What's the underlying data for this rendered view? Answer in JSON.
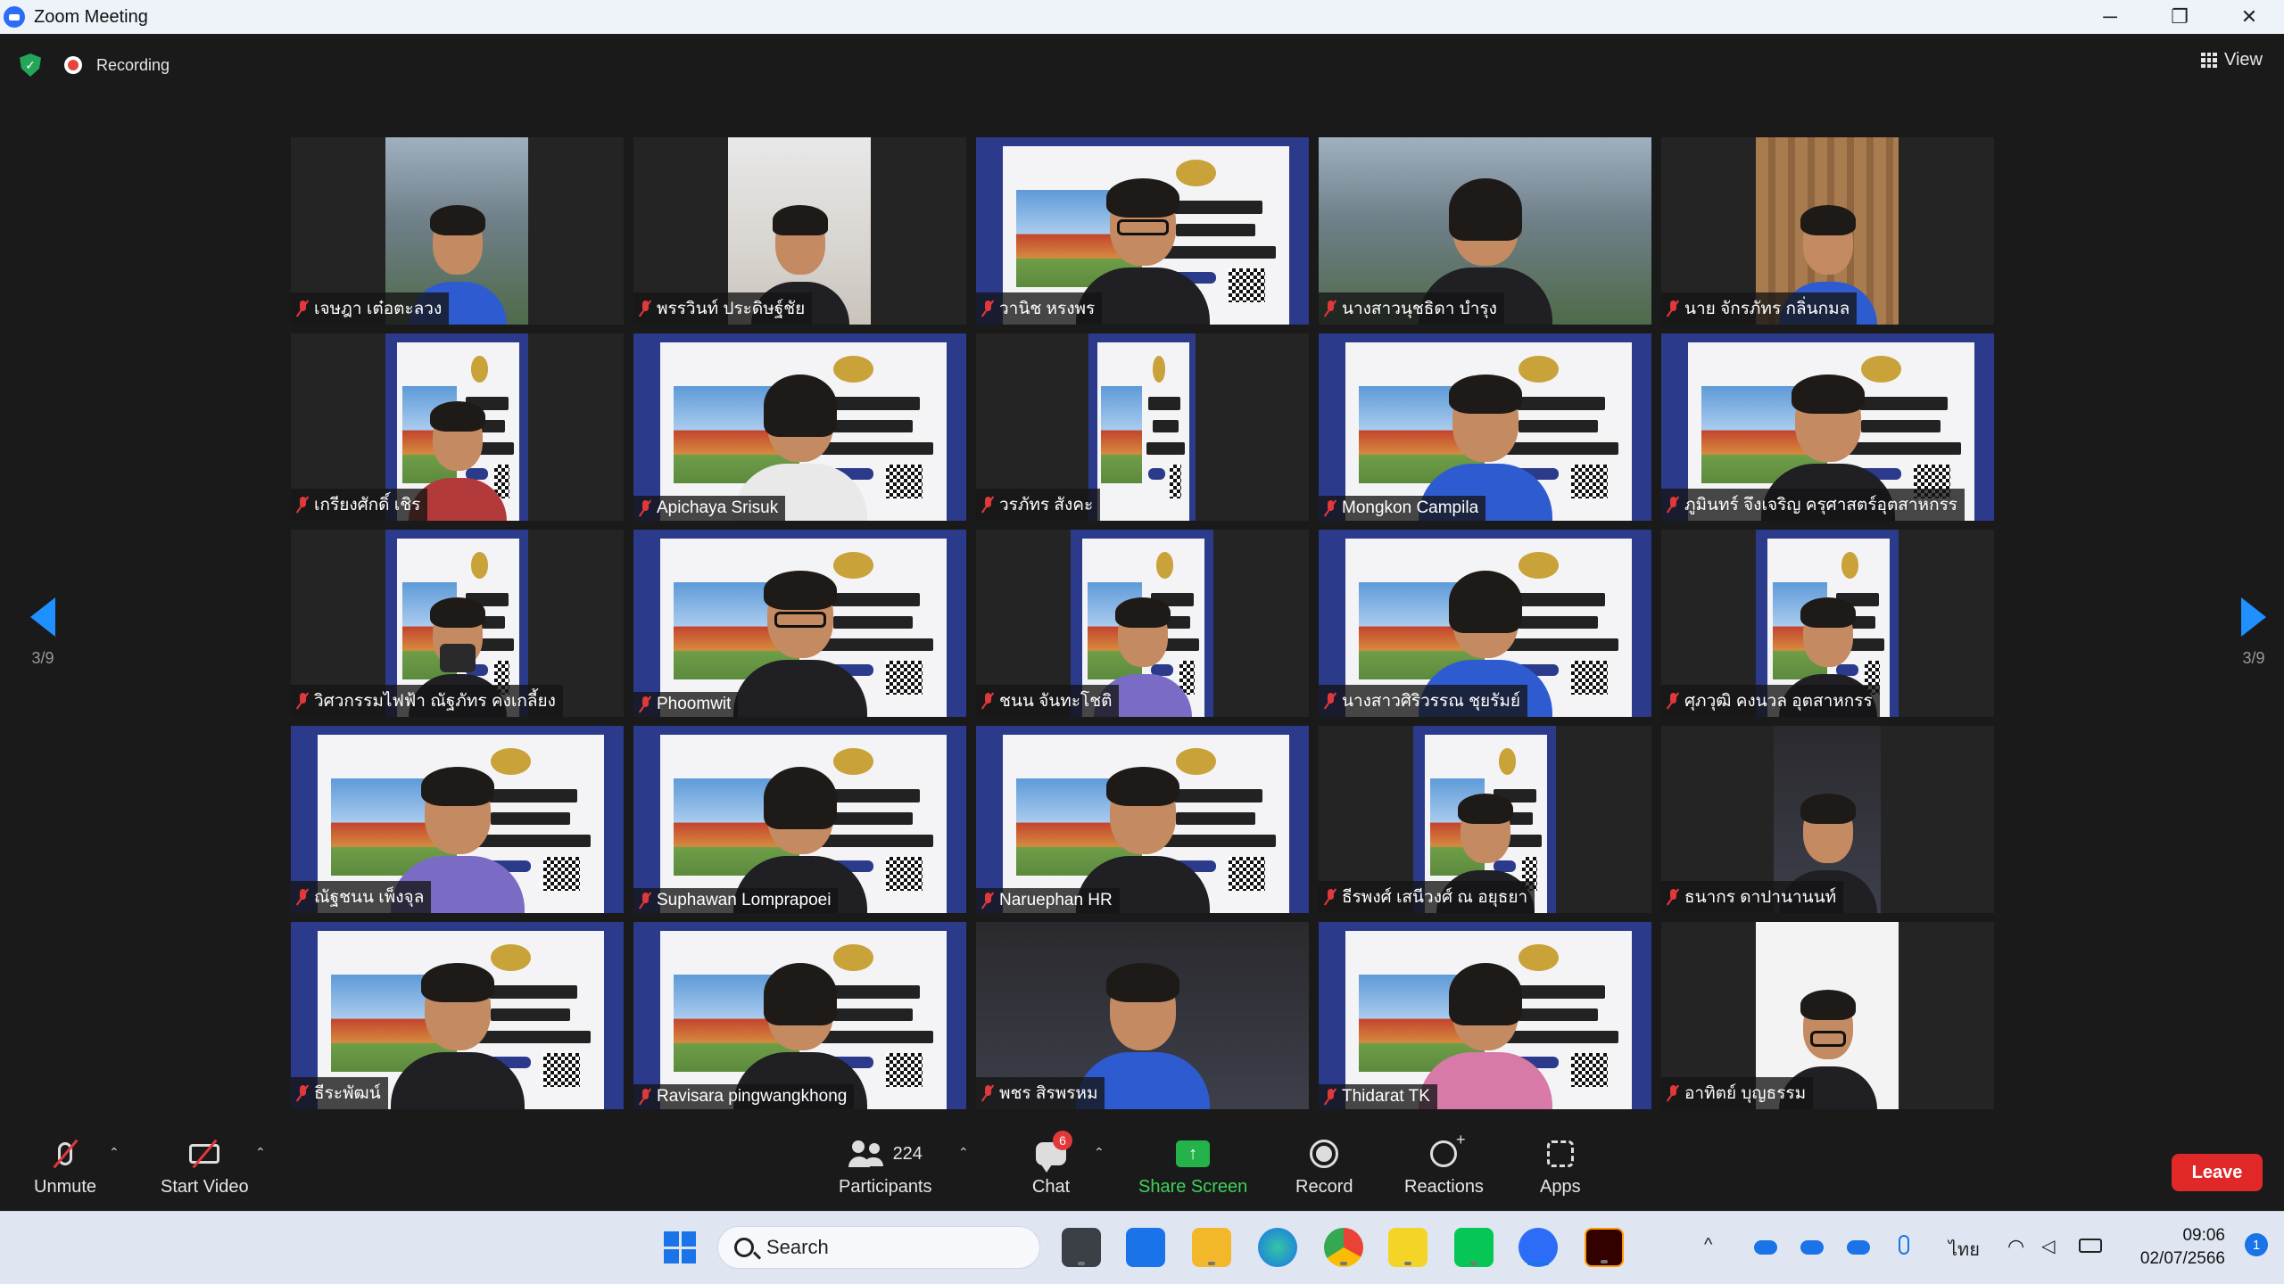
{
  "window": {
    "title": "Zoom Meeting",
    "minimize_glyph": "─",
    "restore_glyph": "❐",
    "close_glyph": "✕"
  },
  "meeting": {
    "recording_label": "Recording",
    "view_label": "View",
    "page_left": "3/9",
    "page_right": "3/9"
  },
  "participants": [
    {
      "name": "เจษฎา เต๋อตะลวง",
      "bg": "outdoor",
      "muted": true
    },
    {
      "name": "พรรวินท์ ประดิษฐ์ชัย",
      "bg": "room",
      "muted": true
    },
    {
      "name": "วานิช หรงพร",
      "bg": "poster",
      "muted": true
    },
    {
      "name": "นางสาวนุชธิดา บำรุง",
      "bg": "outdoor",
      "muted": true
    },
    {
      "name": "นาย จักรภัทร กลิ่นกมล",
      "bg": "wood",
      "muted": true
    },
    {
      "name": "เกรียงศักดิ์ เชิร",
      "bg": "poster",
      "muted": true
    },
    {
      "name": "Apichaya Srisuk",
      "bg": "poster",
      "muted": true
    },
    {
      "name": "วรภัทร สังคะ",
      "bg": "poster",
      "muted": true
    },
    {
      "name": "Mongkon Campila",
      "bg": "poster",
      "muted": true
    },
    {
      "name": "ภูมินทร์ จึงเจริญ ครุศาสตร์อุตสาหกรร",
      "bg": "poster",
      "muted": true
    },
    {
      "name": "วิศวกรรมไฟฟ้า ณัฐภัทร คงเกลี้ยง",
      "bg": "poster",
      "muted": true
    },
    {
      "name": "Phoomwit",
      "bg": "poster",
      "muted": true
    },
    {
      "name": "ชนน จันทะโชติ",
      "bg": "poster",
      "muted": true
    },
    {
      "name": "นางสาวศิริวรรณ ชุยรัมย์",
      "bg": "poster",
      "muted": true
    },
    {
      "name": "ศุภวุฒิ คงนวล อุตสาหกรร",
      "bg": "poster",
      "muted": true
    },
    {
      "name": "ณัฐชนน เพ็งจุล",
      "bg": "poster",
      "muted": true
    },
    {
      "name": "Suphawan Lomprapoei",
      "bg": "poster",
      "muted": true
    },
    {
      "name": "Naruephan HR",
      "bg": "poster",
      "muted": true
    },
    {
      "name": "ธีรพงศ์ เสนีวงศ์ ณ อยุธยา",
      "bg": "poster",
      "muted": true
    },
    {
      "name": "ธนากร ดาปานานนท์",
      "bg": "dark",
      "muted": true
    },
    {
      "name": "ธีระพัฒน์",
      "bg": "poster",
      "muted": true
    },
    {
      "name": "Ravisara pingwangkhong",
      "bg": "poster",
      "muted": true
    },
    {
      "name": "พชร สิรพรหม",
      "bg": "dark",
      "muted": true
    },
    {
      "name": "Thidarat TK",
      "bg": "poster",
      "muted": true
    },
    {
      "name": "อาทิตย์ บุญธรรม",
      "bg": "white",
      "muted": true
    }
  ],
  "toolbar": {
    "unmute_label": "Unmute",
    "start_video_label": "Start Video",
    "participants_label": "Participants",
    "participants_count": "224",
    "chat_label": "Chat",
    "chat_badge": "6",
    "share_label": "Share Screen",
    "share_glyph": "↑",
    "record_label": "Record",
    "reactions_label": "Reactions",
    "apps_label": "Apps",
    "leave_label": "Leave",
    "caret_glyph": "⌃"
  },
  "taskbar": {
    "search_label": "Search",
    "tray_chevron": "^",
    "language": "ไทย",
    "time": "09:06",
    "date": "02/07/2566",
    "notification_count": "1",
    "apps": [
      "task-view",
      "lexis",
      "file-explorer",
      "edge",
      "chrome",
      "sticky-notes",
      "line",
      "zoom",
      "illustrator"
    ]
  },
  "colors": {
    "accent_blue": "#1e90ff",
    "leave_red": "#e02828",
    "share_green": "#3cd35a",
    "muted_red": "#e0383b"
  }
}
